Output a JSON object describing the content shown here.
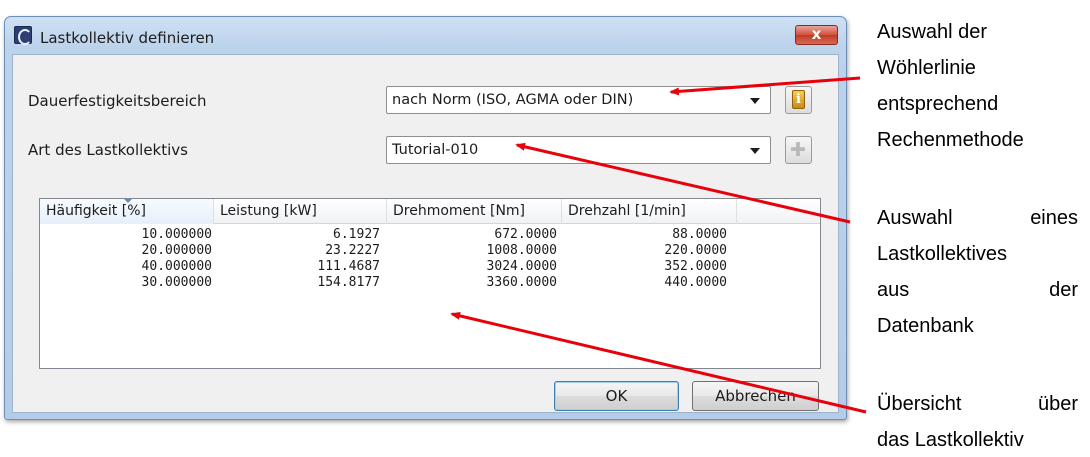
{
  "dialog": {
    "title": "Lastkollektiv definieren",
    "close_label": "x",
    "app_icon": "app-logo-icon"
  },
  "fields": {
    "endurance": {
      "label": "Dauerfestigkeitsbereich",
      "value": "nach Norm (ISO, AGMA oder DIN)",
      "button_icon": "info-icon",
      "button_glyph": "i"
    },
    "collective": {
      "label": "Art des Lastkollektivs",
      "value": "Tutorial-010",
      "button_icon": "add-icon",
      "button_glyph": "✚"
    }
  },
  "table": {
    "columns": [
      "Häufigkeit [%]",
      "Leistung [kW]",
      "Drehmoment [Nm]",
      "Drehzahl [1/min]"
    ],
    "rows": [
      [
        "10.000000",
        "6.1927",
        "672.0000",
        "88.0000"
      ],
      [
        "20.000000",
        "23.2227",
        "1008.0000",
        "220.0000"
      ],
      [
        "40.000000",
        "111.4687",
        "3024.0000",
        "352.0000"
      ],
      [
        "30.000000",
        "154.8177",
        "3360.0000",
        "440.0000"
      ]
    ]
  },
  "buttons": {
    "ok": "OK",
    "cancel": "Abbrechen"
  },
  "annotations": {
    "woehler": {
      "lines": [
        "Auswahl der",
        "Wöhlerlinie",
        "entsprechend",
        "Rechenmethode"
      ]
    },
    "kollektiv": {
      "line1": [
        "Auswahl",
        "eines"
      ],
      "line2": "Lastkollektives",
      "line3": [
        "aus",
        "der"
      ],
      "line4": "Datenbank"
    },
    "overview": {
      "line1": [
        "Übersicht",
        "über"
      ],
      "line2": "das Lastkollektiv"
    },
    "arrow_color": "#e8000b"
  }
}
